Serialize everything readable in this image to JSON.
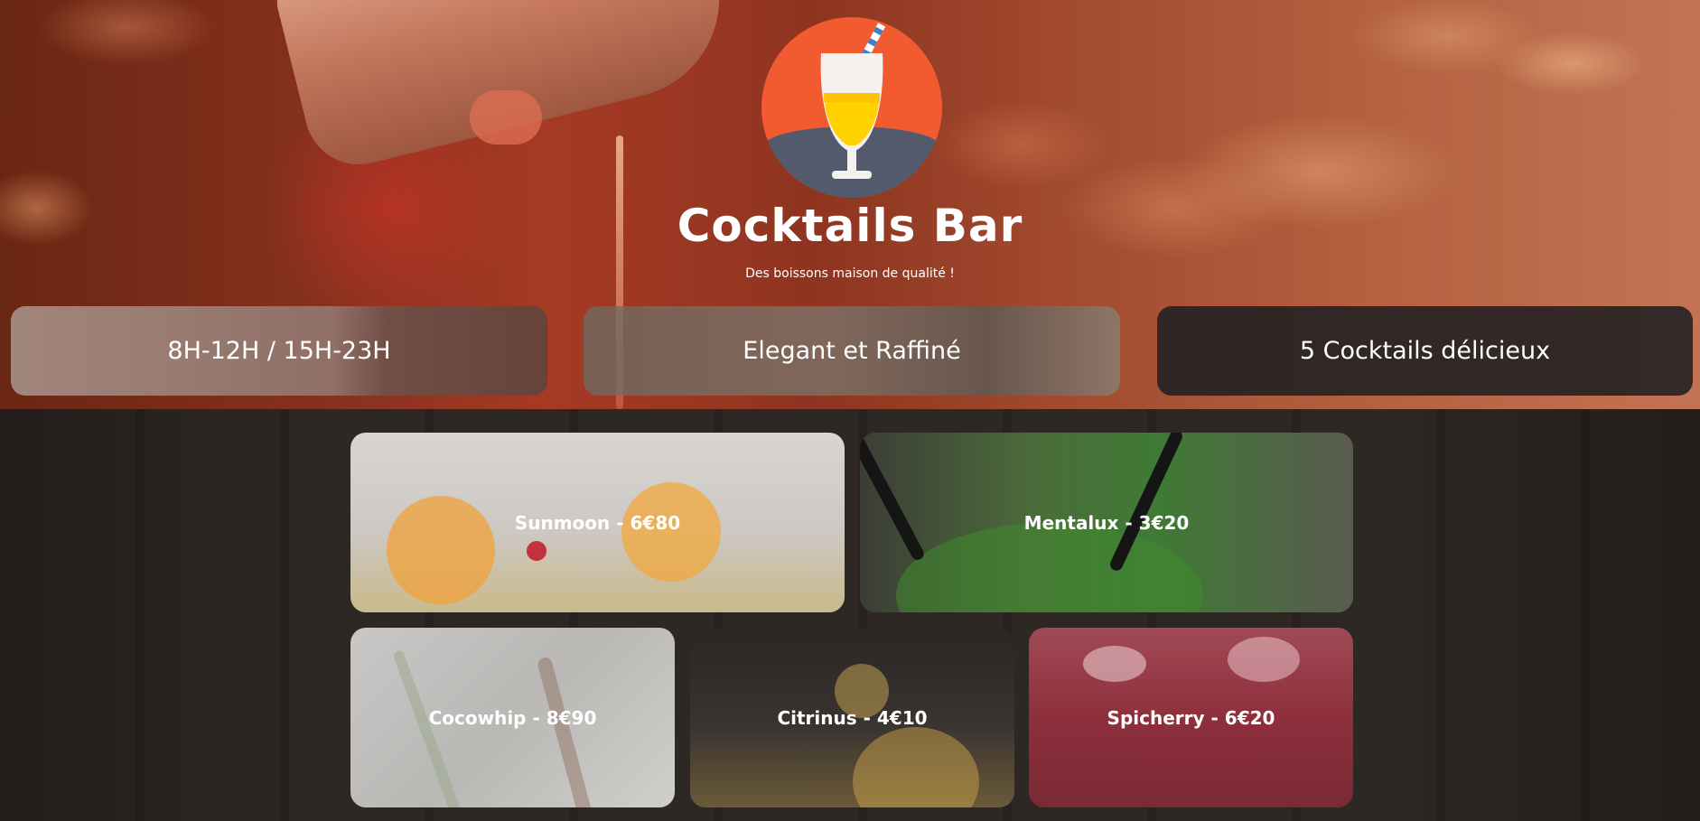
{
  "header": {
    "title": "Cocktails Bar",
    "tagline": "Des boissons maison de qualité !"
  },
  "info_cards": [
    {
      "label": "8H-12H / 15H-23H"
    },
    {
      "label": "Elegant et Raffiné"
    },
    {
      "label": "5 Cocktails délicieux"
    }
  ],
  "cocktails": [
    {
      "label": "Sunmoon - 6€80"
    },
    {
      "label": "Mentalux - 3€20"
    },
    {
      "label": "Cocowhip - 8€90"
    },
    {
      "label": "Citrinus - 4€10"
    },
    {
      "label": "Spicherry - 6€20"
    }
  ],
  "colors": {
    "logo_circle": "#f25a30",
    "logo_base": "#535a6b",
    "drink": "#ffd200",
    "straw": "#3f7fc4"
  }
}
